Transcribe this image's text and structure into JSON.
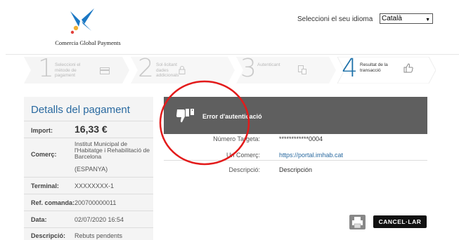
{
  "header": {
    "brand": "Comercia Global Payments",
    "language_label": "Seleccioni el seu idioma",
    "language_value": "Català"
  },
  "steps": [
    {
      "number": "1",
      "label": "Seleccioni el mètode de pagament",
      "icon": "card-icon",
      "active": false
    },
    {
      "number": "2",
      "label": "Sol·licitant dades addicionals",
      "icon": "lock-icon",
      "active": false
    },
    {
      "number": "3",
      "label": "Autenticant",
      "icon": "devices-icon",
      "active": false
    },
    {
      "number": "4",
      "label": "Resultat de la transacció",
      "icon": "thumb-up-icon",
      "active": true
    }
  ],
  "details": {
    "title_a": "Detalls del",
    "title_b": "pagament",
    "import_label": "Import:",
    "import_value": "16,33 €",
    "merchant_label": "Comerç:",
    "merchant_value": "Institut Municipal de l'Habitatge i Rehabilitació de Barcelona",
    "merchant_country": "(ESPANYA)",
    "terminal_label": "Terminal:",
    "terminal_value": "XXXXXXXX-1",
    "order_label": "Ref. comanda:",
    "order_value": "200700000011",
    "date_label": "Data:",
    "date_value": "02/07/2020  16:54",
    "desc_label": "Descripció:",
    "desc_value": "Rebuts pendents"
  },
  "result": {
    "error_title": "Error d'autenticació",
    "card_label": "Número Targeta:",
    "card_value": "************0004",
    "url_label": "Url Comerç:",
    "url_value": "https://portal.imhab.cat",
    "desc_label": "Descripció:",
    "desc_value": "Descripción"
  },
  "actions": {
    "cancel_label": "CANCEL·LAR",
    "print_icon": "printer-icon"
  },
  "colors": {
    "brand_blue": "#1b6fa8",
    "error_banner": "#5f5f5f",
    "annotation_red": "#e31b1b"
  }
}
